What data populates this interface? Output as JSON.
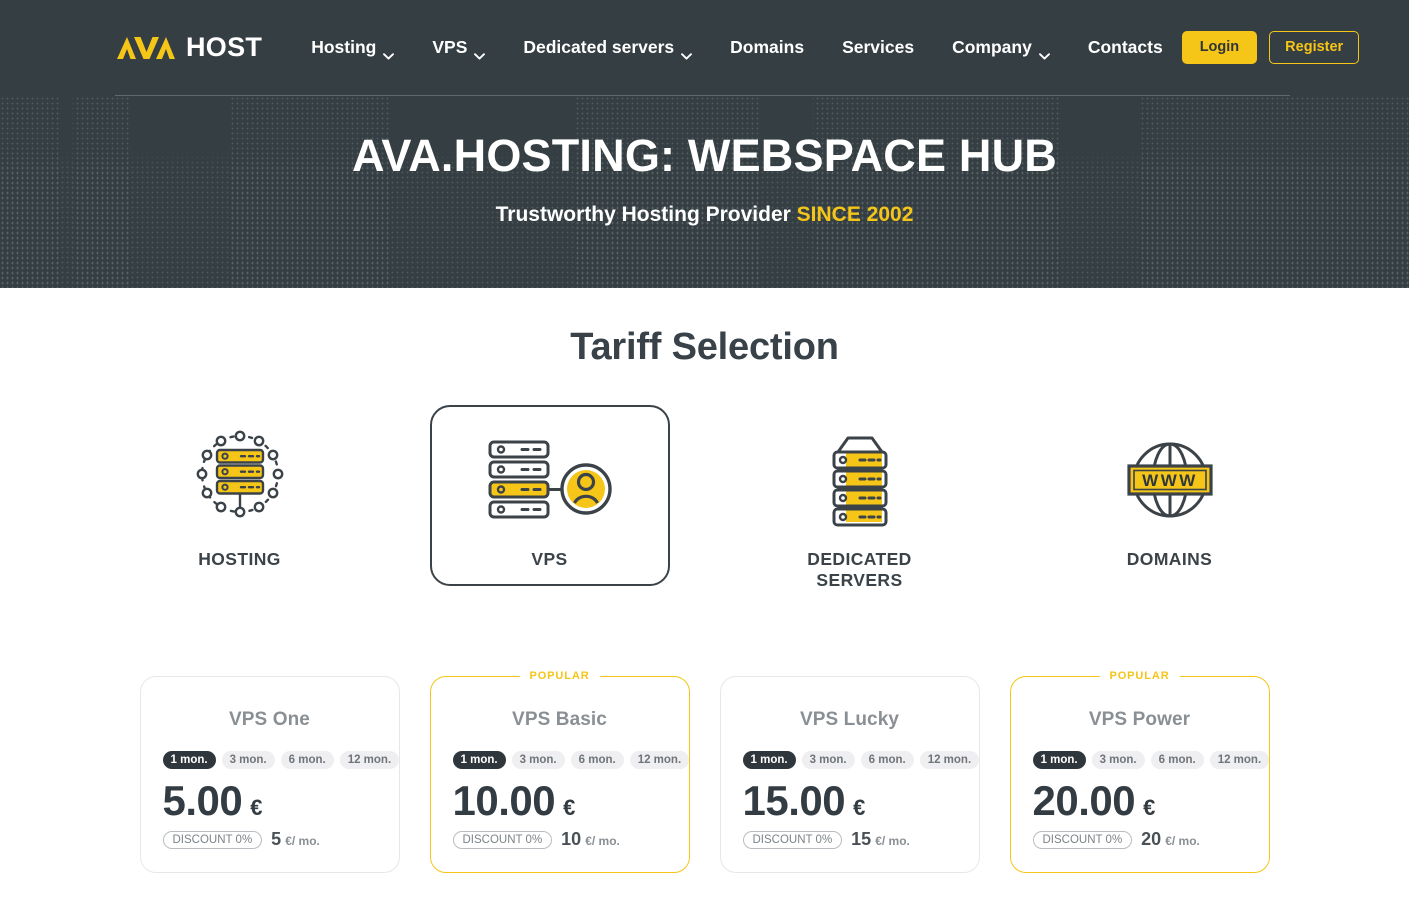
{
  "header": {
    "logo": {
      "mark": "AVA",
      "text": "HOST"
    },
    "nav": [
      {
        "label": "Hosting",
        "has_dropdown": true
      },
      {
        "label": "VPS",
        "has_dropdown": true
      },
      {
        "label": "Dedicated servers",
        "has_dropdown": true
      },
      {
        "label": "Domains",
        "has_dropdown": false
      },
      {
        "label": "Services",
        "has_dropdown": false
      },
      {
        "label": "Company",
        "has_dropdown": true
      },
      {
        "label": "Contacts",
        "has_dropdown": false
      }
    ],
    "login_label": "Login",
    "register_label": "Register"
  },
  "hero": {
    "title": "AVA.HOSTING: WEBSPACE HUB",
    "subtitle_prefix": "Trustworthy Hosting Provider",
    "subtitle_accent": "SINCE 2002"
  },
  "tariff": {
    "section_title": "Tariff Selection",
    "categories": [
      {
        "label": "HOSTING",
        "icon": "network-server-icon",
        "selected": false
      },
      {
        "label": "VPS",
        "icon": "vps-server-user-icon",
        "selected": true
      },
      {
        "label": "DEDICATED\nSERVERS",
        "icon": "server-rack-icon",
        "selected": false
      },
      {
        "label": "DOMAINS",
        "icon": "globe-www-icon",
        "selected": false
      }
    ]
  },
  "plans": {
    "popular_label": "POPULAR",
    "terms": [
      "1 mon.",
      "3 mon.",
      "6 mon.",
      "12 mon."
    ],
    "active_term": "1 mon.",
    "currency": "€",
    "per_month_unit": "€/ mo.",
    "items": [
      {
        "name": "VPS One",
        "price": "5.00",
        "currency": "€",
        "discount": "DISCOUNT 0%",
        "per_month": "5",
        "per_month_unit": "€/ mo.",
        "popular": false
      },
      {
        "name": "VPS Basic",
        "price": "10.00",
        "currency": "€",
        "discount": "DISCOUNT 0%",
        "per_month": "10",
        "per_month_unit": "€/ mo.",
        "popular": true
      },
      {
        "name": "VPS Lucky",
        "price": "15.00",
        "currency": "€",
        "discount": "DISCOUNT 0%",
        "per_month": "15",
        "per_month_unit": "€/ mo.",
        "popular": false
      },
      {
        "name": "VPS Power",
        "price": "20.00",
        "currency": "€",
        "discount": "DISCOUNT 0%",
        "per_month": "20",
        "per_month_unit": "€/ mo.",
        "popular": true
      }
    ]
  },
  "colors": {
    "dark": "#353F43",
    "accent_yellow": "#F5C518",
    "text_dark": "#333C42",
    "muted": "#8A8F94"
  }
}
